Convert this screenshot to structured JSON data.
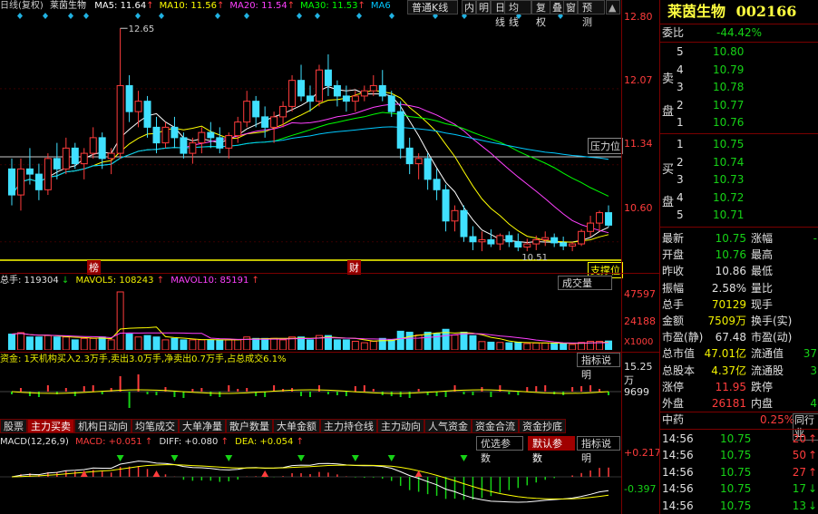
{
  "header": {
    "prefix": "日线(复权)",
    "stock_name": "莱茵生物",
    "ma_items": [
      {
        "label": "MA5: 11.64",
        "color": "#ffffff",
        "arrow": "up"
      },
      {
        "label": "MA10: 11.56",
        "color": "#ffff00",
        "arrow": "up"
      },
      {
        "label": "MA20: 11.54",
        "color": "#ff40ff",
        "arrow": "up"
      },
      {
        "label": "MA30: 11.53",
        "color": "#00ff00",
        "arrow": "up"
      },
      {
        "label": "MA6",
        "color": "#00c8ff",
        "arrow": ""
      }
    ],
    "toolbar": [
      "普通K线",
      "内",
      "明",
      "日线",
      "均线",
      "复权",
      "叠",
      "窗",
      "预测"
    ]
  },
  "price_axis": [
    "12.80",
    "12.07",
    "11.34",
    "10.60"
  ],
  "annotations": {
    "high_label": "12.65",
    "low_label": "10.51",
    "pressure_label": "压力位",
    "marker_1": "榜",
    "marker_2": "财",
    "marker_3": "支撑位"
  },
  "volume_panel": {
    "header": "总手: 119304",
    "mavol5": "MAVOL5: 108243",
    "mavol10": "MAVOL10: 85191",
    "type_button": "成交量",
    "axis": [
      "47597",
      "24188",
      "X1000"
    ]
  },
  "fund_panel": {
    "header": "资金: 1天机构买入2.3万手,卖出3.0万手,净卖出0.7万手,占总成交6.1%",
    "button": "指标说明",
    "axis": [
      "15.25万",
      "9699"
    ]
  },
  "tabs": [
    "股票",
    "主力买卖",
    "机构日动向",
    "均笔成交",
    "大单净量",
    "散户数量",
    "大单金额",
    "主力持仓线",
    "主力动向",
    "人气资金",
    "资金合流",
    "资金抄底"
  ],
  "active_tab": 1,
  "macd_panel": {
    "header": "MACD(12,26,9)",
    "macd": "MACD: +0.051",
    "diff": "DIFF: +0.080",
    "dea": "DEA: +0.054",
    "buttons": [
      "优选参数",
      "默认参数",
      "指标说明"
    ],
    "axis": [
      "+0.217",
      "-0.397"
    ]
  },
  "quote": {
    "title": "莱茵生物",
    "code": "002166",
    "webi_label": "委比",
    "webi_value": "-44.42%",
    "sell_label": [
      "卖",
      "盘"
    ],
    "buy_label": [
      "买",
      "盘"
    ],
    "sells": [
      {
        "n": "5",
        "price": "10.80"
      },
      {
        "n": "4",
        "price": "10.79"
      },
      {
        "n": "3",
        "price": "10.78"
      },
      {
        "n": "2",
        "price": "10.77"
      },
      {
        "n": "1",
        "price": "10.76"
      }
    ],
    "buys": [
      {
        "n": "1",
        "price": "10.75"
      },
      {
        "n": "2",
        "price": "10.74"
      },
      {
        "n": "3",
        "price": "10.73"
      },
      {
        "n": "4",
        "price": "10.72"
      },
      {
        "n": "5",
        "price": "10.71"
      }
    ],
    "stats": [
      {
        "l": "最新",
        "v": "10.75",
        "vc": "grn",
        "l2": "涨幅",
        "v2": "-"
      },
      {
        "l": "开盘",
        "v": "10.76",
        "vc": "grn",
        "l2": "最高",
        "v2": ""
      },
      {
        "l": "昨收",
        "v": "10.86",
        "vc": "wht",
        "l2": "最低",
        "v2": ""
      },
      {
        "l": "振幅",
        "v": "2.58%",
        "vc": "wht",
        "l2": "量比",
        "v2": ""
      },
      {
        "l": "总手",
        "v": "70129",
        "vc": "yel",
        "l2": "现手",
        "v2": ""
      },
      {
        "l": "金额",
        "v": "7509万",
        "vc": "yel",
        "l2": "换手(实)",
        "v2": ""
      },
      {
        "l": "市盈(静)",
        "v": "67.48",
        "vc": "wht",
        "l2": "市盈(动)",
        "v2": ""
      },
      {
        "l": "总市值",
        "v": "47.01亿",
        "vc": "yel",
        "l2": "流通值",
        "v2": "37"
      },
      {
        "l": "总股本",
        "v": "4.37亿",
        "vc": "yel",
        "l2": "流通股",
        "v2": "3"
      },
      {
        "l": "涨停",
        "v": "11.95",
        "vc": "red",
        "l2": "跌停",
        "v2": ""
      },
      {
        "l": "外盘",
        "v": "26181",
        "vc": "red",
        "l2": "内盘",
        "v2": "4"
      }
    ],
    "sector": "中药",
    "sector_change": "0.25%",
    "sector_tab": "同行业",
    "ticks": [
      {
        "t": "14:56",
        "p": "10.75",
        "v": "20",
        "d": "up"
      },
      {
        "t": "14:56",
        "p": "10.75",
        "v": "50",
        "d": "up"
      },
      {
        "t": "14:56",
        "p": "10.75",
        "v": "27",
        "d": "up"
      },
      {
        "t": "14:56",
        "p": "10.75",
        "v": "17",
        "d": "down"
      },
      {
        "t": "14:56",
        "p": "10.75",
        "v": "13",
        "d": "down"
      }
    ]
  },
  "chart_data": {
    "type": "candlestick",
    "ylim": [
      10.45,
      12.8
    ],
    "ohlc": [
      [
        11.3,
        11.4,
        10.95,
        11.05
      ],
      [
        11.05,
        11.4,
        10.9,
        11.3
      ],
      [
        11.3,
        11.5,
        11.15,
        11.25
      ],
      [
        11.25,
        11.35,
        11.0,
        11.1
      ],
      [
        11.1,
        11.45,
        11.05,
        11.4
      ],
      [
        11.4,
        11.55,
        11.2,
        11.3
      ],
      [
        11.3,
        11.6,
        11.25,
        11.5
      ],
      [
        11.5,
        11.55,
        11.3,
        11.35
      ],
      [
        11.35,
        11.5,
        11.2,
        11.45
      ],
      [
        11.45,
        11.7,
        11.4,
        11.6
      ],
      [
        11.6,
        11.65,
        11.3,
        11.4
      ],
      [
        11.4,
        11.5,
        11.25,
        11.45
      ],
      [
        11.45,
        12.65,
        11.4,
        12.1
      ],
      [
        12.1,
        12.2,
        11.75,
        11.85
      ],
      [
        11.85,
        12.05,
        11.7,
        11.95
      ],
      [
        11.95,
        12.0,
        11.6,
        11.7
      ],
      [
        11.7,
        11.8,
        11.45,
        11.55
      ],
      [
        11.55,
        11.75,
        11.5,
        11.7
      ],
      [
        11.7,
        11.8,
        11.5,
        11.6
      ],
      [
        11.6,
        11.65,
        11.4,
        11.45
      ],
      [
        11.45,
        11.6,
        11.35,
        11.55
      ],
      [
        11.55,
        11.7,
        11.45,
        11.65
      ],
      [
        11.65,
        11.75,
        11.5,
        11.6
      ],
      [
        11.6,
        11.7,
        11.45,
        11.5
      ],
      [
        11.5,
        11.65,
        11.4,
        11.62
      ],
      [
        11.62,
        11.8,
        11.55,
        11.75
      ],
      [
        11.75,
        12.05,
        11.7,
        11.95
      ],
      [
        11.95,
        12.0,
        11.7,
        11.8
      ],
      [
        11.8,
        11.9,
        11.6,
        11.7
      ],
      [
        11.7,
        11.85,
        11.55,
        11.8
      ],
      [
        11.8,
        11.95,
        11.7,
        11.9
      ],
      [
        11.9,
        12.2,
        11.85,
        12.15
      ],
      [
        12.15,
        12.3,
        11.95,
        12.0
      ],
      [
        12.0,
        12.1,
        11.85,
        11.95
      ],
      [
        11.95,
        12.3,
        11.9,
        12.25
      ],
      [
        12.25,
        12.4,
        12.0,
        12.1
      ],
      [
        12.1,
        12.15,
        11.9,
        12.0
      ],
      [
        12.0,
        12.1,
        11.85,
        11.95
      ],
      [
        11.95,
        12.05,
        11.85,
        12.0
      ],
      [
        12.0,
        12.1,
        11.95,
        12.05
      ],
      [
        12.05,
        12.2,
        12.0,
        12.1
      ],
      [
        12.1,
        12.25,
        11.95,
        12.0
      ],
      [
        12.0,
        12.05,
        11.8,
        11.85
      ],
      [
        11.85,
        11.95,
        11.4,
        11.5
      ],
      [
        11.5,
        11.6,
        11.25,
        11.35
      ],
      [
        11.35,
        11.45,
        11.2,
        11.4
      ],
      [
        11.4,
        11.45,
        11.1,
        11.2
      ],
      [
        11.2,
        11.3,
        11.0,
        11.1
      ],
      [
        11.1,
        11.15,
        10.7,
        10.8
      ],
      [
        10.8,
        10.95,
        10.7,
        10.9
      ],
      [
        10.9,
        10.95,
        10.6,
        10.65
      ],
      [
        10.65,
        10.75,
        10.52,
        10.6
      ],
      [
        10.6,
        10.7,
        10.51,
        10.62
      ],
      [
        10.62,
        10.72,
        10.55,
        10.58
      ],
      [
        10.58,
        10.68,
        10.52,
        10.66
      ],
      [
        10.66,
        10.7,
        10.55,
        10.6
      ],
      [
        10.6,
        10.68,
        10.51,
        10.55
      ],
      [
        10.55,
        10.63,
        10.51,
        10.58
      ],
      [
        10.58,
        10.66,
        10.52,
        10.62
      ],
      [
        10.62,
        10.7,
        10.56,
        10.64
      ],
      [
        10.64,
        10.68,
        10.55,
        10.59
      ],
      [
        10.59,
        10.65,
        10.52,
        10.56
      ],
      [
        10.56,
        10.6,
        10.51,
        10.58
      ],
      [
        10.58,
        10.72,
        10.56,
        10.7
      ],
      [
        10.7,
        10.85,
        10.65,
        10.78
      ],
      [
        10.78,
        10.9,
        10.7,
        10.88
      ],
      [
        10.88,
        10.95,
        10.74,
        10.76
      ]
    ]
  }
}
